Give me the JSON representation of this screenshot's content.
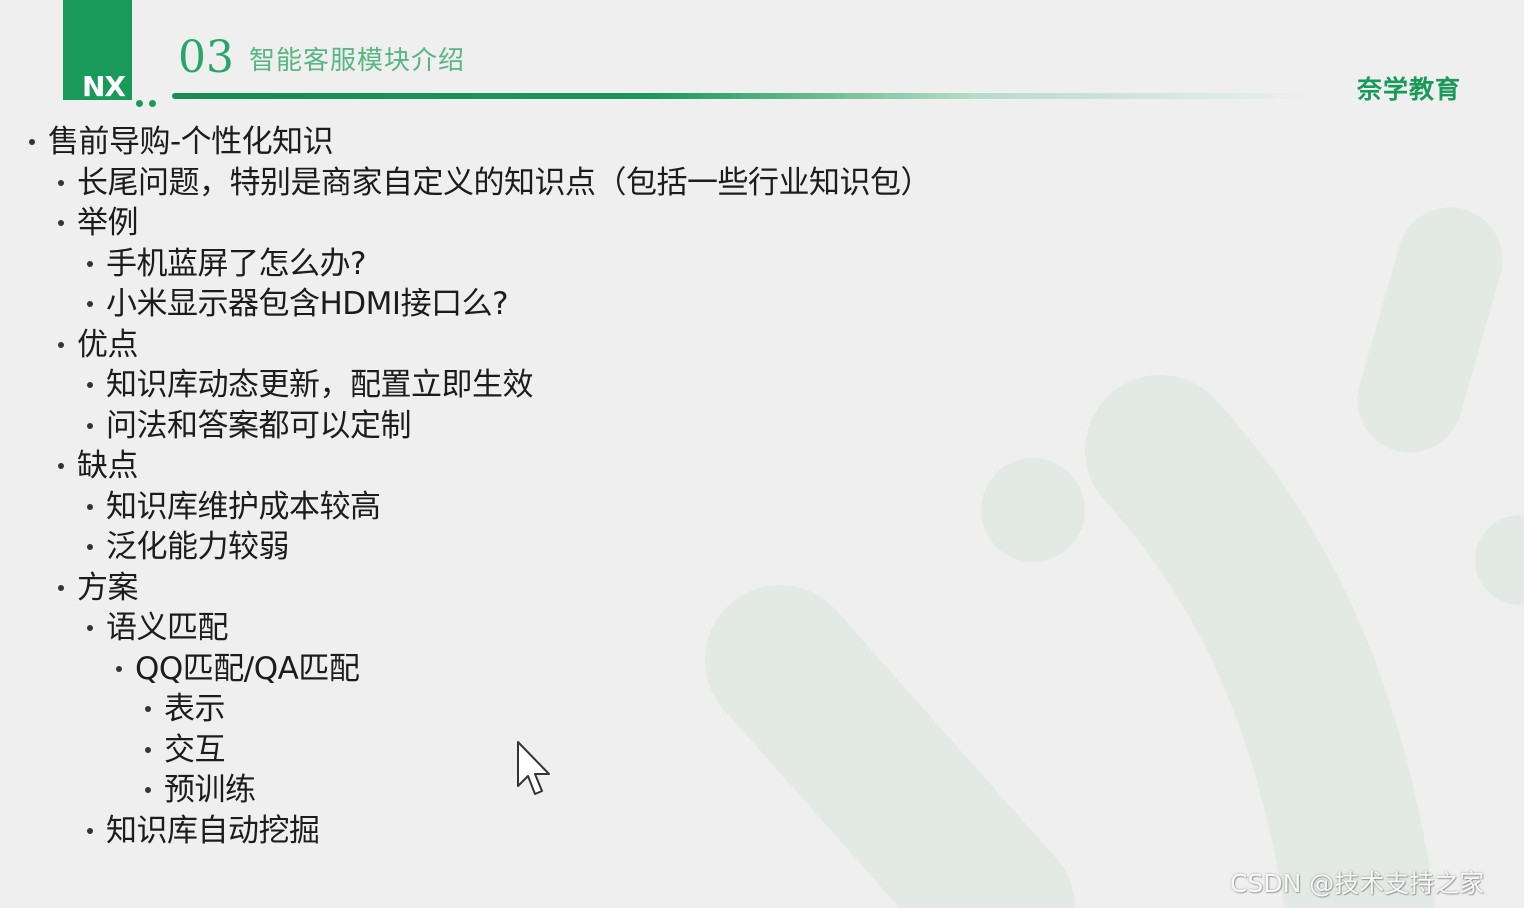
{
  "header": {
    "logo_text": "NX",
    "section_number": "03",
    "section_title": "智能客服模块介绍",
    "brand": "奈学教育"
  },
  "bullets": [
    {
      "level": 1,
      "text": "售前导购-个性化知识"
    },
    {
      "level": 2,
      "text": "长尾问题，特别是商家自定义的知识点（包括一些行业知识包）"
    },
    {
      "level": 2,
      "text": "举例"
    },
    {
      "level": 3,
      "text": "手机蓝屏了怎么办?"
    },
    {
      "level": 3,
      "text": "小米显示器包含HDMI接口么?"
    },
    {
      "level": 2,
      "text": "优点"
    },
    {
      "level": 3,
      "text": "知识库动态更新，配置立即生效"
    },
    {
      "level": 3,
      "text": "问法和答案都可以定制"
    },
    {
      "level": 2,
      "text": "缺点"
    },
    {
      "level": 3,
      "text": "知识库维护成本较高"
    },
    {
      "level": 3,
      "text": "泛化能力较弱"
    },
    {
      "level": 2,
      "text": "方案"
    },
    {
      "level": 3,
      "text": "语义匹配"
    },
    {
      "level": 4,
      "text": "QQ匹配/QA匹配"
    },
    {
      "level": 5,
      "text": "表示"
    },
    {
      "level": 5,
      "text": "交互"
    },
    {
      "level": 5,
      "text": "预训练"
    },
    {
      "level": 3,
      "text": "知识库自动挖掘"
    }
  ],
  "watermark_text": "CSDN @技术支持之家",
  "colors": {
    "brand_green": "#1a9a5a",
    "title_green": "#58b584",
    "background": "#efefef"
  }
}
